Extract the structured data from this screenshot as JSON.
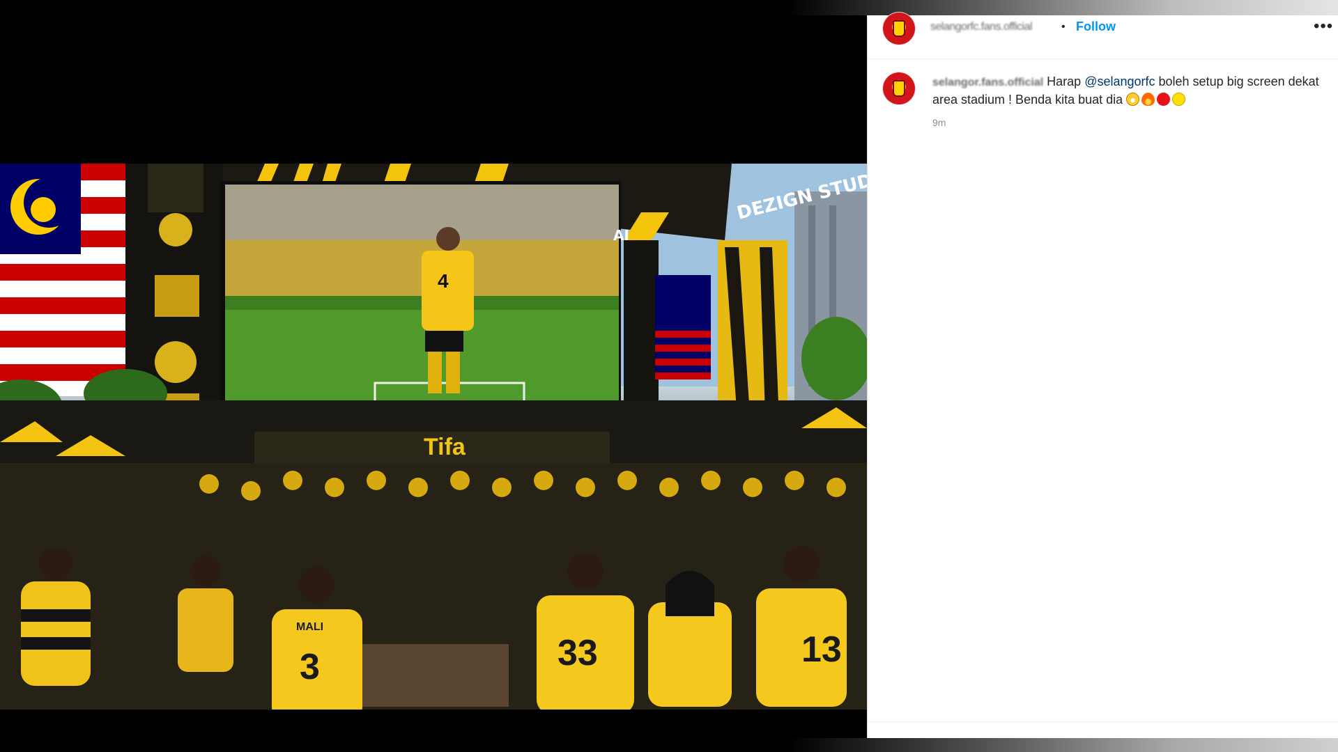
{
  "post": {
    "image_description_icon": "post-image",
    "image_text": {
      "watermark_left": "AI",
      "watermark_right": "DEZIGN STUDIO",
      "banner": "Tifa",
      "jersey_center": "4",
      "jersey_left": "3",
      "jersey_middle": "33",
      "jersey_right": "13",
      "jersey_name": "MALI"
    }
  },
  "header": {
    "username": "selangorfc.fans.official",
    "separator": "•",
    "follow_label": "Follow",
    "more_label": "•••"
  },
  "comment": {
    "username": "selangor.fans.official",
    "text_before": " Harap ",
    "mention": "@selangorfc",
    "text_after": " boleh setup big screen dekat area stadium ! Benda kita buat dia ",
    "time": "9m"
  },
  "colors": {
    "accent_blue": "#0095f6",
    "mention_blue": "#00376b",
    "brand_yellow": "#ffd200",
    "brand_red": "#d4141b"
  }
}
